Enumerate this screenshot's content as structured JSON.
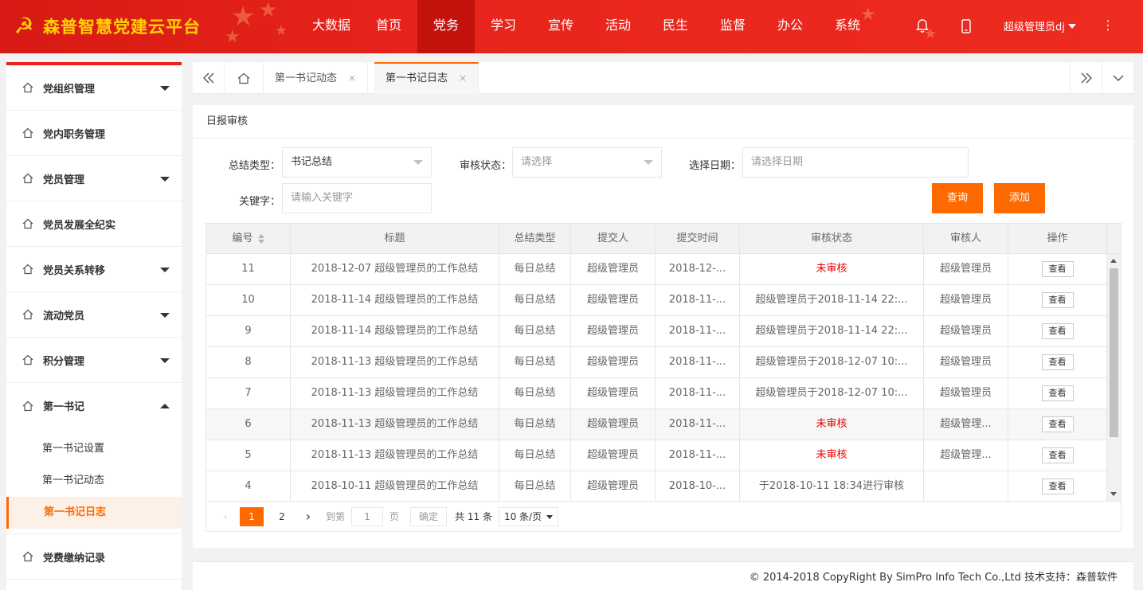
{
  "header": {
    "title": "森普智慧党建云平台",
    "logo_icon": "hammer-sickle-icon",
    "nav": [
      "大数据",
      "首页",
      "党务",
      "学习",
      "宣传",
      "活动",
      "民生",
      "监督",
      "办公",
      "系统"
    ],
    "nav_active_index": 2,
    "user": "超级管理员dj",
    "icons": [
      "bell-icon",
      "mobile-icon",
      "more-vertical-icon"
    ]
  },
  "sidebar": {
    "items": [
      {
        "label": "党组织管理",
        "arrow": "down"
      },
      {
        "label": "党内职务管理",
        "arrow": ""
      },
      {
        "label": "党员管理",
        "arrow": "down"
      },
      {
        "label": "党员发展全纪实",
        "arrow": ""
      },
      {
        "label": "党员关系转移",
        "arrow": "down"
      },
      {
        "label": "流动党员",
        "arrow": "down"
      },
      {
        "label": "积分管理",
        "arrow": "down"
      },
      {
        "label": "第一书记",
        "arrow": "up"
      }
    ],
    "subitems": [
      "第一书记设置",
      "第一书记动态",
      "第一书记日志"
    ],
    "active_sub": 2,
    "after": {
      "label": "党费缴纳记录"
    }
  },
  "tabs": {
    "items": [
      {
        "label": "第一书记动态",
        "close": "×"
      },
      {
        "label": "第一书记日志",
        "close": "×"
      }
    ],
    "active": 1
  },
  "card": {
    "title": "日报审核",
    "filters": {
      "type_label": "总结类型：",
      "type_value": "书记总结",
      "status_label": "审核状态：",
      "status_placeholder": "请选择",
      "date_label": "选择日期：",
      "date_placeholder": "请选择日期",
      "keyword_label": "关键字：",
      "keyword_placeholder": "请输入关键字"
    },
    "buttons": {
      "query": "查询",
      "add": "添加"
    }
  },
  "table": {
    "columns": [
      "编号",
      "标题",
      "总结类型",
      "提交人",
      "提交时间",
      "审核状态",
      "审核人",
      "操作"
    ],
    "rows": [
      {
        "id": "11",
        "title": "2018-12-07 超级管理员的工作总结",
        "type": "每日总结",
        "submitter": "超级管理员",
        "time": "2018-12-...",
        "status": "未审核",
        "reviewer": "超级管理员",
        "action": "查看"
      },
      {
        "id": "10",
        "title": "2018-11-14 超级管理员的工作总结",
        "type": "每日总结",
        "submitter": "超级管理员",
        "time": "2018-11-...",
        "status": "超级管理员于2018-11-14 22:...",
        "reviewer": "超级管理员",
        "action": "查看"
      },
      {
        "id": "9",
        "title": "2018-11-14 超级管理员的工作总结",
        "type": "每日总结",
        "submitter": "超级管理员",
        "time": "2018-11-...",
        "status": "超级管理员于2018-11-14 22:...",
        "reviewer": "超级管理员",
        "action": "查看"
      },
      {
        "id": "8",
        "title": "2018-11-13 超级管理员的工作总结",
        "type": "每日总结",
        "submitter": "超级管理员",
        "time": "2018-11-...",
        "status": "超级管理员于2018-12-07 10:...",
        "reviewer": "超级管理员",
        "action": "查看"
      },
      {
        "id": "7",
        "title": "2018-11-13 超级管理员的工作总结",
        "type": "每日总结",
        "submitter": "超级管理员",
        "time": "2018-11-...",
        "status": "超级管理员于2018-12-07 10:...",
        "reviewer": "超级管理员",
        "action": "查看"
      },
      {
        "id": "6",
        "title": "2018-11-13 超级管理员的工作总结",
        "type": "每日总结",
        "submitter": "超级管理员",
        "time": "2018-11-...",
        "status": "未审核",
        "reviewer": "超级管理...",
        "action": "查看"
      },
      {
        "id": "5",
        "title": "2018-11-13 超级管理员的工作总结",
        "type": "每日总结",
        "submitter": "超级管理员",
        "time": "2018-11-...",
        "status": "未审核",
        "reviewer": "超级管理...",
        "action": "查看"
      },
      {
        "id": "4",
        "title": "2018-10-11 超级管理员的工作总结",
        "type": "每日总结",
        "submitter": "超级管理员",
        "time": "2018-10-...",
        "status": "于2018-10-11 18:34进行审核",
        "reviewer": "",
        "action": "查看"
      }
    ],
    "highlight_row": 5
  },
  "pager": {
    "prev": "‹",
    "pages": [
      "1",
      "2"
    ],
    "current": "1",
    "next": "›",
    "goto_label": "到第",
    "goto_value": "1",
    "page_unit": "页",
    "confirm": "确定",
    "total": "共 11 条",
    "page_size": "10 条/页"
  },
  "footer": {
    "text": "© 2014-2018 CopyRight By SimPro Info Tech Co.,Ltd 技术支持：森普软件"
  }
}
